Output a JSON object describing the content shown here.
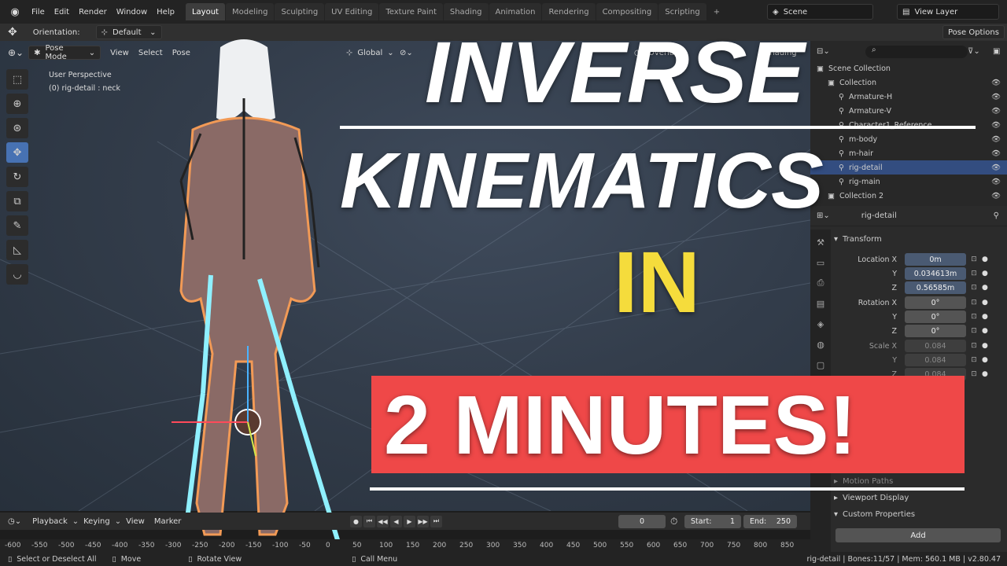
{
  "topbar": {
    "menu": [
      "File",
      "Edit",
      "Render",
      "Window",
      "Help"
    ],
    "workspaces": [
      "Layout",
      "Modeling",
      "Sculpting",
      "UV Editing",
      "Texture Paint",
      "Shading",
      "Animation",
      "Rendering",
      "Compositing",
      "Scripting"
    ],
    "active_workspace": "Layout",
    "add_tab": "+",
    "scene": "Scene",
    "view_layer": "View Layer"
  },
  "tool_header": {
    "orientation_label": "Orientation:",
    "orientation_value": "Default",
    "pose_options": "Pose Options"
  },
  "viewport_header": {
    "mode": "Pose Mode",
    "menus": [
      "View",
      "Select",
      "Pose"
    ],
    "transform_orientation": "Global",
    "overlays": "Overlays",
    "shading": "Shading"
  },
  "viewport": {
    "perspective": "User Perspective",
    "active": "(0) rig-detail : neck"
  },
  "toolbar_icons": [
    "select-box-icon",
    "cursor-icon",
    "move-icon",
    "move-selected-icon",
    "rotate-icon",
    "scale-icon",
    "annotate-icon",
    "measure-icon",
    "bone-roll-icon"
  ],
  "outliner": {
    "search_placeholder": "",
    "rows": [
      {
        "name": "Scene Collection",
        "indent": 0
      },
      {
        "name": "Collection",
        "indent": 1
      },
      {
        "name": "Armature-H",
        "indent": 2
      },
      {
        "name": "Armature-V",
        "indent": 2
      },
      {
        "name": "Character1_Reference",
        "indent": 2
      },
      {
        "name": "m-body",
        "indent": 2
      },
      {
        "name": "m-hair",
        "indent": 2
      },
      {
        "name": "rig-detail",
        "indent": 2
      },
      {
        "name": "rig-main",
        "indent": 2
      },
      {
        "name": "Collection 2",
        "indent": 1
      }
    ]
  },
  "properties": {
    "object_name": "rig-detail",
    "transform_header": "Transform",
    "location": {
      "label": "Location X",
      "x": "0m",
      "y": "0.034613m",
      "z": "0.56585m"
    },
    "rotation": {
      "label": "Rotation X",
      "x": "0°",
      "y": "0°",
      "z": "0°"
    },
    "scale": {
      "label": "Scale X",
      "x": "0.084",
      "y": "0.084",
      "z": "0.084"
    },
    "axis_y": "Y",
    "axis_z": "Z",
    "sections": [
      "Motion Paths",
      "Viewport Display",
      "Custom Properties"
    ],
    "add_button": "Add"
  },
  "timeline": {
    "menus": [
      "Playback",
      "Keying",
      "View",
      "Marker"
    ],
    "current_frame": "0",
    "start_label": "Start:",
    "start": "1",
    "end_label": "End:",
    "end": "250",
    "ruler": [
      "-600",
      "-550",
      "-500",
      "-450",
      "-400",
      "-350",
      "-300",
      "-250",
      "-200",
      "-150",
      "-100",
      "-50",
      "0",
      "50",
      "100",
      "150",
      "200",
      "250",
      "300",
      "350",
      "400",
      "450",
      "500",
      "550",
      "600",
      "650",
      "700",
      "750",
      "800",
      "850"
    ]
  },
  "status": {
    "select": "Select or Deselect All",
    "move": "Move",
    "rotate": "Rotate View",
    "call_menu": "Call Menu",
    "info": "rig-detail | Bones:11/57 | Mem: 560.1 MB | v2.80.47"
  },
  "overlay_title": {
    "line1": "INVERSE",
    "line2": "KINEMATICS",
    "line3": "IN",
    "line4": "2 MINUTES!",
    "accent_yellow": "#f5dc3c",
    "banner_red": "#ef4848"
  }
}
